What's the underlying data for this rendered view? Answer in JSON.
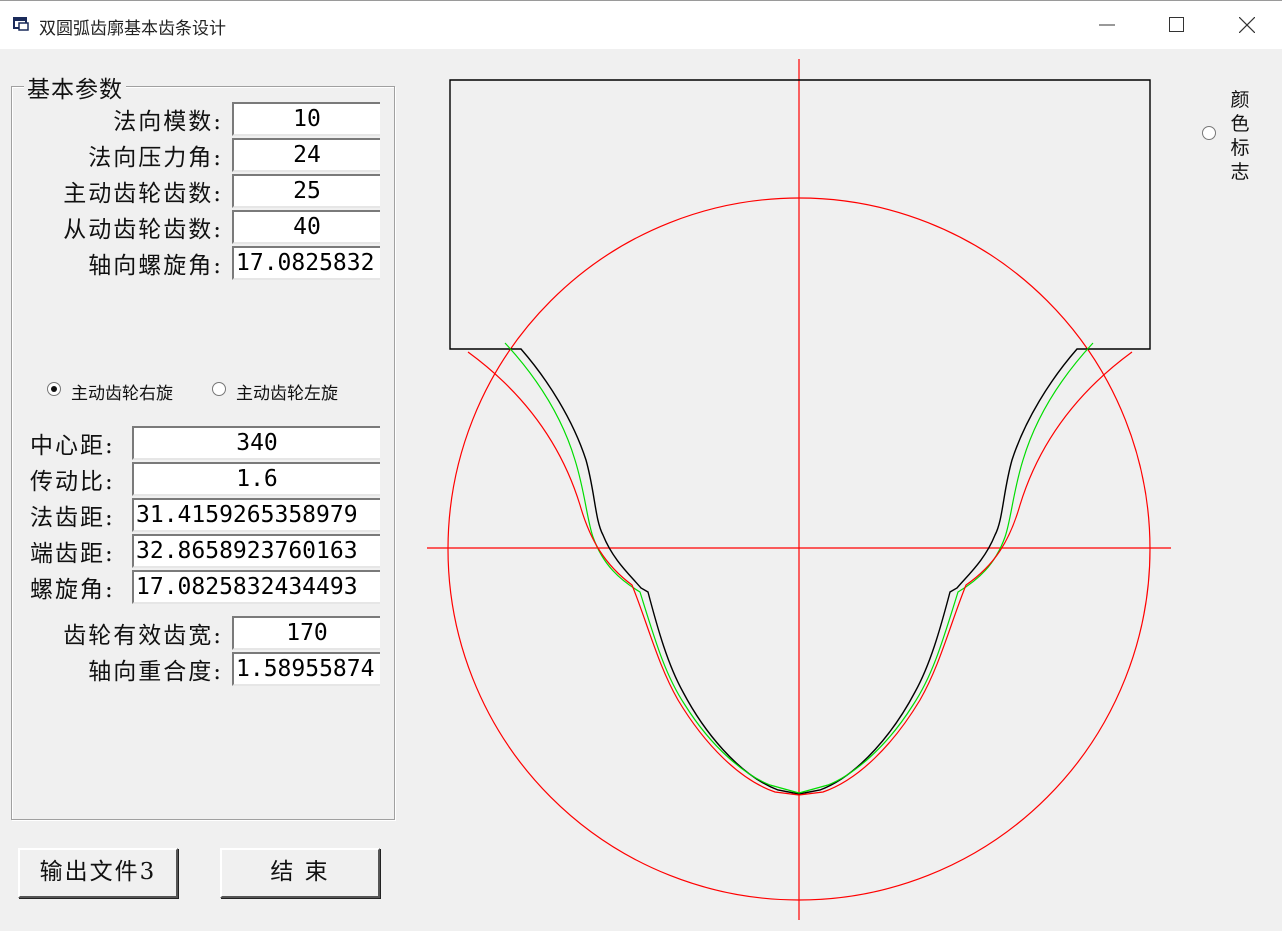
{
  "window": {
    "title": "双圆弧齿廓基本齿条设计",
    "minimize_icon": "minimize-icon",
    "maximize_icon": "maximize-icon",
    "close_icon": "close-icon"
  },
  "basic_params": {
    "legend": "基本参数",
    "fields": [
      {
        "label": "法向模数:",
        "value": "10"
      },
      {
        "label": "法向压力角:",
        "value": "24"
      },
      {
        "label": "主动齿轮齿数:",
        "value": "25"
      },
      {
        "label": "从动齿轮齿数:",
        "value": "40"
      },
      {
        "label": "轴向螺旋角:",
        "value": "17.0825832"
      }
    ]
  },
  "rotation": {
    "right_label": "主动齿轮右旋",
    "left_label": "主动齿轮左旋",
    "selected": "right"
  },
  "computed": {
    "fields": [
      {
        "label": "中心距:",
        "value": "340"
      },
      {
        "label": "传动比:",
        "value": "1.6"
      },
      {
        "label": "法齿距:",
        "value": "31.4159265358979"
      },
      {
        "label": "端齿距:",
        "value": "32.8658923760163"
      },
      {
        "label": "螺旋角:",
        "value": "17.0825832434493"
      }
    ]
  },
  "face": {
    "fields": [
      {
        "label": "齿轮有效齿宽:",
        "value": "170"
      },
      {
        "label": "轴向重合度:",
        "value": "1.58955874"
      }
    ]
  },
  "buttons": {
    "output": "输出文件3",
    "end": "结 束"
  },
  "color_flag": {
    "label": "颜色标志",
    "checked": false
  },
  "colors": {
    "profile": "#000000",
    "reference": "#ff0000",
    "offset_curve": "#00dd00"
  }
}
